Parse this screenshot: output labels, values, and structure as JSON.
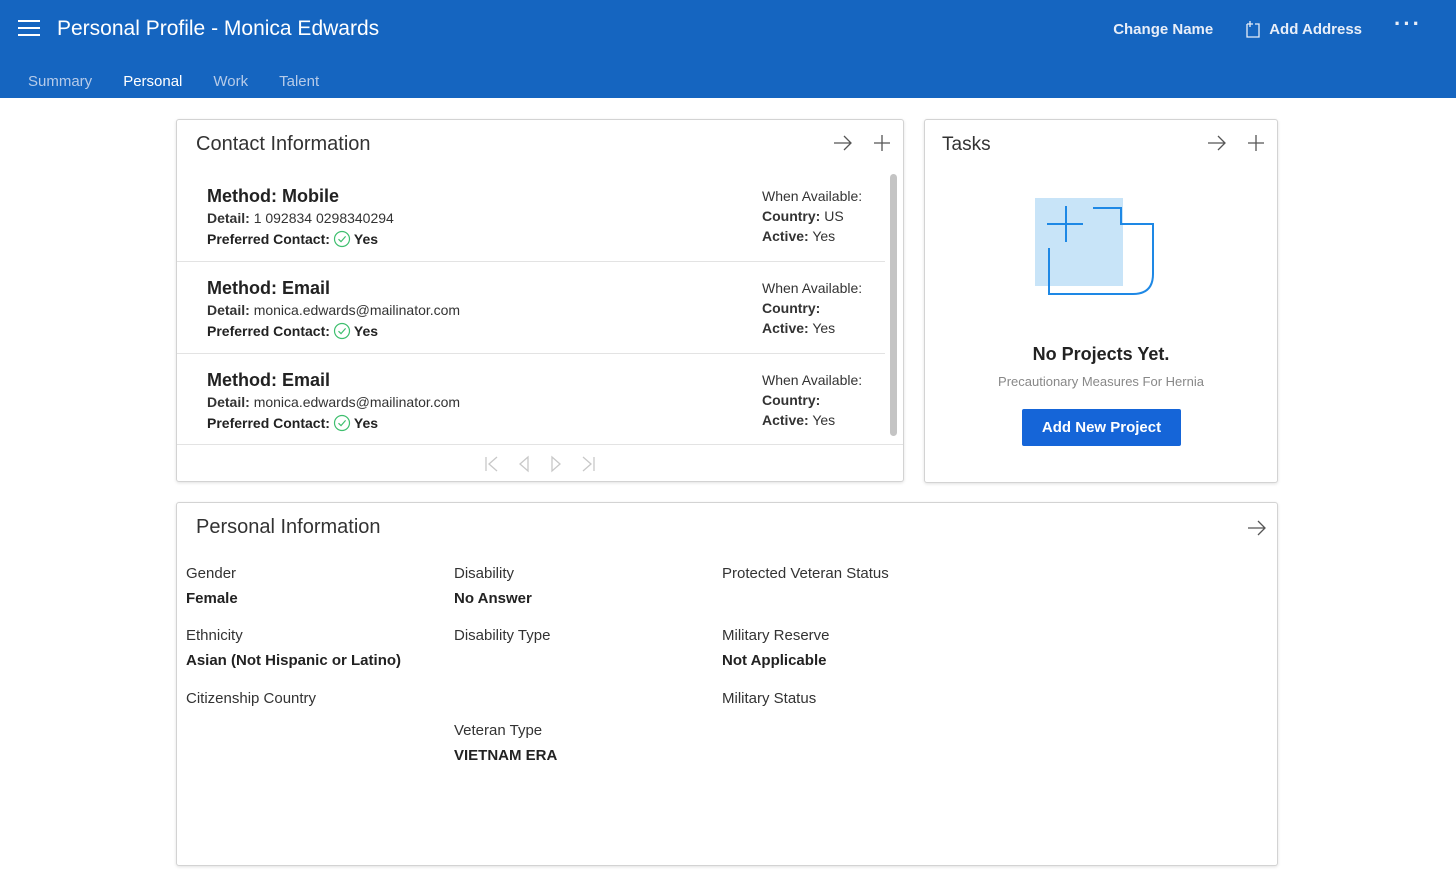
{
  "header": {
    "title": "Personal Profile - Monica Edwards",
    "change_name": "Change Name",
    "add_address": "Add Address",
    "more": "···"
  },
  "tabs": [
    {
      "label": "Summary",
      "active": false
    },
    {
      "label": "Personal",
      "active": true
    },
    {
      "label": "Work",
      "active": false
    },
    {
      "label": "Talent",
      "active": false
    }
  ],
  "contact": {
    "title": "Contact Information",
    "labels": {
      "method": "Method:",
      "detail": "Detail:",
      "preferred": "Preferred Contact:",
      "when": "When Available:",
      "country": "Country:",
      "active": "Active:"
    },
    "items": [
      {
        "method": "Mobile",
        "detail": "1 092834 0298340294",
        "preferred": "Yes",
        "when": "",
        "country": "US",
        "active": "Yes"
      },
      {
        "method": "Email",
        "detail": "monica.edwards@mailinator.com",
        "preferred": "Yes",
        "when": "",
        "country": "",
        "active": "Yes"
      },
      {
        "method": "Email",
        "detail": "monica.edwards@mailinator.com",
        "preferred": "Yes",
        "when": "",
        "country": "",
        "active": "Yes"
      }
    ]
  },
  "tasks": {
    "title": "Tasks",
    "empty_title": "No Projects Yet.",
    "empty_sub": "Precautionary Measures For Hernia",
    "add_button": "Add New Project"
  },
  "personal": {
    "title": "Personal Information",
    "gender_label": "Gender",
    "gender": "Female",
    "disability_label": "Disability",
    "disability": "No Answer",
    "protected_label": "Protected Veteran Status",
    "ethnicity_label": "Ethnicity",
    "ethnicity": "Asian (Not Hispanic or Latino)",
    "disability_type_label": "Disability Type",
    "military_reserve_label": "Military Reserve",
    "military_reserve": "Not Applicable",
    "citizenship_label": "Citizenship Country",
    "military_status_label": "Military Status",
    "veteran_type_label": "Veteran Type",
    "veteran_type": "VIETNAM ERA"
  },
  "colors": {
    "header_bg": "#1565c0",
    "primary_button": "#1565d8",
    "check_green": "#3fbf6f"
  }
}
